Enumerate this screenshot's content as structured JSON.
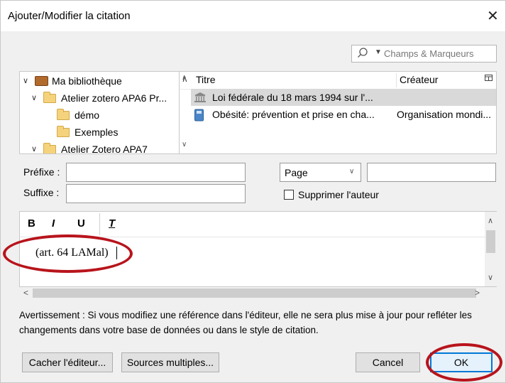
{
  "window": {
    "title": "Ajouter/Modifier la citation",
    "close_glyph": "✕"
  },
  "search": {
    "placeholder": "Champs & Marqueurs",
    "dropdown_glyph": "▼"
  },
  "library_tree": {
    "items": [
      {
        "label": "Ma bibliothèque",
        "type": "library",
        "expanded": true
      },
      {
        "label": "Atelier zotero APA6 Pr...",
        "type": "folder",
        "expanded": true
      },
      {
        "label": "démo",
        "type": "folder"
      },
      {
        "label": "Exemples",
        "type": "folder"
      },
      {
        "label": "Atelier Zotero APA7",
        "type": "folder",
        "expanded": true
      }
    ]
  },
  "items_table": {
    "columns": {
      "title": "Titre",
      "creator": "Créateur"
    },
    "rows": [
      {
        "title": "Loi fédérale du 18 mars 1994 sur l'...",
        "creator": "",
        "icon": "statute-icon",
        "selected": true
      },
      {
        "title": "Obésité: prévention et prise en cha...",
        "creator": "Organisation mondi...",
        "icon": "book-icon",
        "selected": false
      }
    ]
  },
  "form": {
    "prefix_label": "Préfixe :",
    "prefix_value": "",
    "suffix_label": "Suffixe :",
    "suffix_value": "",
    "locator_selected": "Page",
    "locator_value": "",
    "suppress_author_label": "Supprimer l'auteur",
    "suppress_author_checked": false
  },
  "editor": {
    "toolbar": {
      "bold": "B",
      "italic": "I",
      "underline": "U",
      "clear_format": "T"
    },
    "citation_text": "(art. 64 LAMal)"
  },
  "warning_text": "Avertissement : Si vous modifiez une référence dans l'éditeur, elle ne sera plus mise à jour pour refléter les changements dans votre base de données ou dans le style de citation.",
  "buttons": {
    "hide_editor": "Cacher l'éditeur...",
    "multiple_sources": "Sources multiples...",
    "cancel": "Cancel",
    "ok": "OK"
  },
  "colors": {
    "annotation": "#b8141c",
    "ok_focus": "#0078d7",
    "selected_row": "#d9d9d9"
  }
}
